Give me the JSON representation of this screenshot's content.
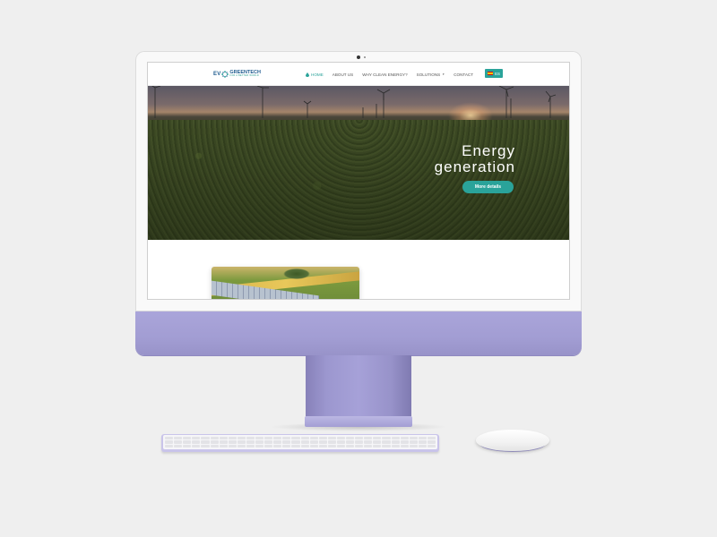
{
  "site": {
    "logo": {
      "prefix": "EV",
      "name": "GREENTECH",
      "tagline": "FOR A BETTER WORLD"
    },
    "nav": [
      {
        "label": "HOME",
        "icon": "drop-icon",
        "active": true
      },
      {
        "label": "ABOUT US",
        "active": false
      },
      {
        "label": "WHY CLEAN ENERGY?",
        "active": false
      },
      {
        "label": "SOLUTIONS",
        "dropdown": true,
        "active": false
      },
      {
        "label": "CONTACT",
        "active": false
      }
    ],
    "language": {
      "code": "ES",
      "flag": "spain-flag-icon"
    },
    "hero": {
      "title_line1": "Energy",
      "title_line2": "generation",
      "cta_label": "More details"
    },
    "colors": {
      "accent": "#2aa39a",
      "logo_blue": "#1f5c8f",
      "device_lavender": "#a29dd3"
    }
  }
}
